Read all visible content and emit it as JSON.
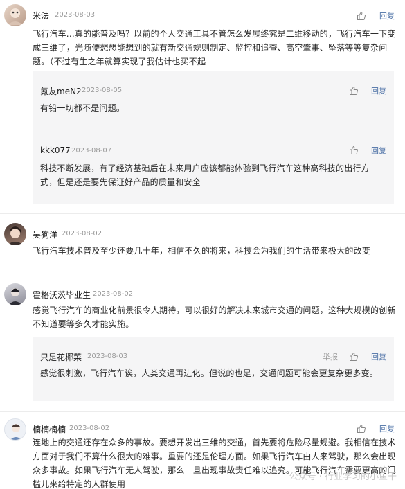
{
  "comments": [
    {
      "user": "米法",
      "date": "2023-08-03",
      "reply_label": "回复",
      "text": "飞行汽车...真的能普及吗？以前的个人交通工具不管怎么发展终究是二维移动的，飞行汽车一下变成三维了，光随便想想能想到的就有新交通规则制定、监控和追查、高空肇事、坠落等等复杂问题。（不过有生之年就算实现了我估计也买不起",
      "replies": [
        {
          "user": "氪友meN2",
          "date": "2023-08-05",
          "reply_label": "回复",
          "text": "有铅一切都不是问题。"
        },
        {
          "user": "kkk077",
          "date": "2023-08-07",
          "reply_label": "回复",
          "text": "科技不断发展，有了经济基础后在未来用户应该都能体验到飞行汽车这种高科技的出行方式，但是还是要先保证好产品的质量和安全"
        }
      ]
    },
    {
      "user": "吴狗洋",
      "date": "2023-08-02",
      "text": "飞行汽车技术普及至少还要几十年，相信不久的将来，科技会为我们的生活带来极大的改变"
    },
    {
      "user": "霍格沃茨毕业生",
      "date": "2023-08-02",
      "text": "感觉飞行汽车的商业化前景很令人期待，可以很好的解决未来城市交通的问题，这种大规模的创新不知道要等多久才能实施。",
      "replies": [
        {
          "user": "只是花椰菜",
          "date": "2023-08-03",
          "report_label": "举报",
          "reply_label": "回复",
          "text": "感觉很刺激，飞行汽车诶，人类交通再进化。但说的也是，交通问题可能会更复杂更多变。"
        }
      ]
    },
    {
      "user": "楠楠楠楠",
      "date": "2023-08-02",
      "reply_label": "回复",
      "text": "连地上的交通还存在众多的事故。要想开发出三维的交通，首先要将危险尽量规避。我相信在技术方面对于我们不算什么很大的难事。重要的还是伦理方面。如果飞行汽车由人来驾驶，那么会出现众多事故。如果飞行汽车无人驾驶，那么一旦出现事故责任难以追究。可能飞行汽车需要更高的门槛儿来给特定的人群使用"
    }
  ],
  "watermark": "公众号 · 行业学习的小鱼干",
  "colors": {
    "reply_link": "#4a6fa5",
    "sub_bg": "#f5f5f6",
    "date": "#9a9a9a"
  },
  "icons": {
    "like": "thumbs-up-icon"
  }
}
